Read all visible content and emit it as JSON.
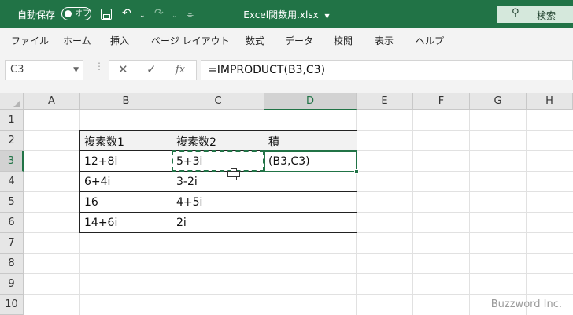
{
  "titlebar": {
    "autosave_label": "自動保存",
    "autosave_state": "オフ",
    "filename": "Excel関数用.xlsx",
    "search_label": "検索"
  },
  "menu": [
    "ファイル",
    "ホーム",
    "挿入",
    "ページ レイアウト",
    "数式",
    "データ",
    "校閲",
    "表示",
    "ヘルプ"
  ],
  "formula_bar": {
    "name_box": "C3",
    "formula": "=IMPRODUCT(B3,C3)"
  },
  "grid": {
    "columns": [
      "A",
      "B",
      "C",
      "D",
      "E",
      "F",
      "G",
      "H"
    ],
    "selected_column": "D",
    "rows": [
      "1",
      "2",
      "3",
      "4",
      "5",
      "6",
      "7",
      "8",
      "9",
      "10"
    ],
    "selected_row": "3",
    "table": {
      "headers": [
        "複素数1",
        "複素数2",
        "積"
      ],
      "rows": [
        [
          "12+8i",
          "5+3i",
          "(B3,C3)"
        ],
        [
          "6+4i",
          "3-2i",
          ""
        ],
        [
          "16",
          "4+5i",
          ""
        ],
        [
          "14+6i",
          "2i",
          ""
        ]
      ]
    }
  },
  "watermark": "Buzzword Inc.",
  "colors": {
    "accent": "#217346"
  }
}
